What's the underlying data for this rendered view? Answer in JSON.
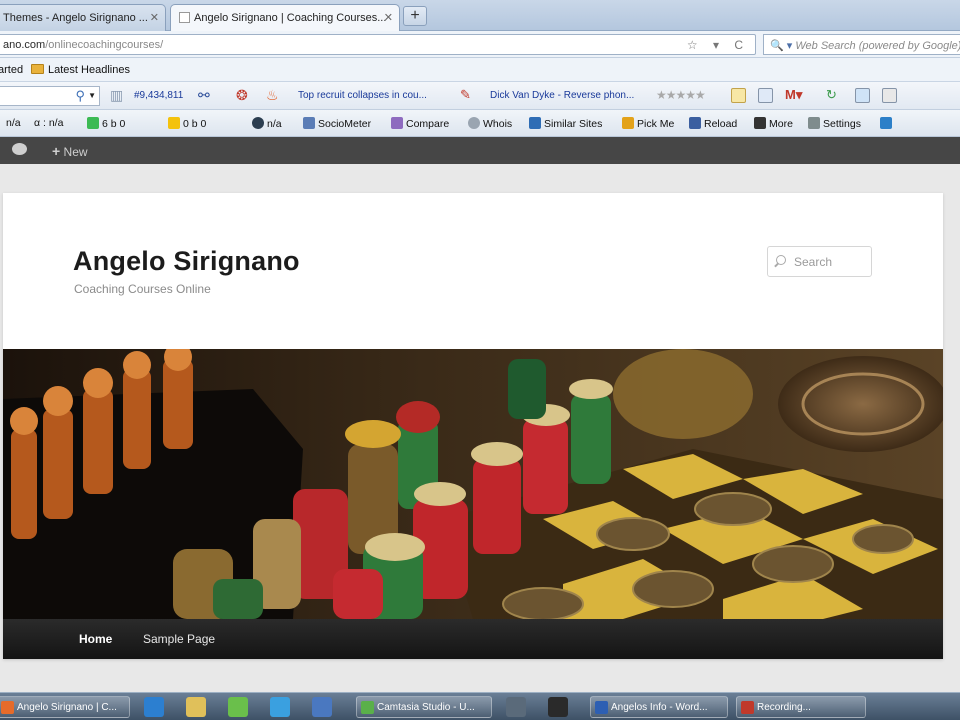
{
  "browser": {
    "tabs": [
      {
        "title": "Themes - Angelo Sirignano ...",
        "active": false
      },
      {
        "title": "Angelo Sirignano | Coaching Courses...",
        "active": true
      }
    ],
    "new_tab_label": "+",
    "url_host": "ano.com",
    "url_path": "/onlinecoachingcourses/",
    "url_controls": "☆ ▾ C",
    "web_search_placeholder": "Web Search (powered by Google)",
    "web_search_prefix": "🔍 ▾"
  },
  "bookmarks": {
    "items": [
      {
        "label": "arted"
      },
      {
        "label": "Latest Headlines"
      }
    ]
  },
  "toolbar2": {
    "rank": "#9,434,811",
    "news1": "Top recruit collapses in cou...",
    "news2": "Dick Van Dyke - Reverse phon...",
    "stars": "★★★★★"
  },
  "toolbar3": {
    "items": [
      {
        "label": "n/a"
      },
      {
        "label": "α : n/a"
      },
      {
        "label": "6  b  0"
      },
      {
        "label": "0  b  0"
      },
      {
        "label": "n/a"
      },
      {
        "label": "SocioMeter"
      },
      {
        "label": "Compare"
      },
      {
        "label": "Whois"
      },
      {
        "label": "Similar Sites"
      },
      {
        "label": "Pick Me"
      },
      {
        "label": "Reload"
      },
      {
        "label": "More"
      },
      {
        "label": "Settings"
      }
    ]
  },
  "adminbar": {
    "new_label": "New"
  },
  "site": {
    "title": "Angelo Sirignano",
    "description": "Coaching Courses Online",
    "search_placeholder": "Search",
    "nav": [
      {
        "label": "Home"
      },
      {
        "label": "Sample Page"
      }
    ]
  },
  "taskbar": {
    "windows": [
      {
        "label": "Angelo Sirignano | C..."
      },
      {
        "label": "Camtasia Studio - U..."
      },
      {
        "label": "Angelos Info - Word..."
      },
      {
        "label": "Recording..."
      }
    ]
  },
  "colors": {
    "adminbar": "#464646",
    "nav_bar": "#1e1e1e",
    "link_blue": "#1a3a9a"
  }
}
